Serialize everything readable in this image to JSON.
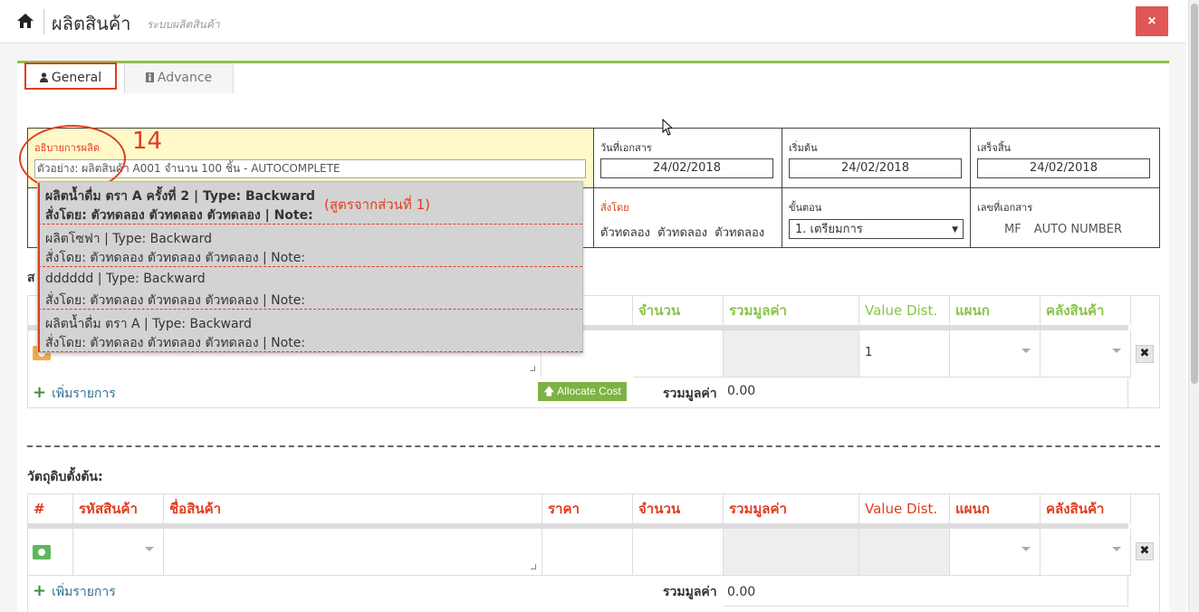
{
  "header": {
    "title": "ผลิตสินค้า",
    "subtitle": "ระบบผลิตสินค้า",
    "close_label": "×"
  },
  "tabs": [
    {
      "label": "General"
    },
    {
      "label": "Advance"
    }
  ],
  "form": {
    "description_label": "อธิบายการผลิต",
    "description_placeholder": "ตัวอย่าง: ผลิตสินค้า A001 จำนวน 100 ชิ้น - AUTOCOMPLETE",
    "doc_date_label": "วันที่เอกสาร",
    "doc_date": "24/02/2018",
    "start_label": "เริ่มต้น",
    "start_date": "24/02/2018",
    "end_label": "เสร็จสิ้น",
    "end_date": "24/02/2018",
    "ordered_by_label": "สั่งโดย",
    "ordered_by": "ตัวทดลอง  ตัวทดลอง  ตัวทดลอง",
    "step_label": "ขั้นตอน",
    "step_value": "1. เตรียมการ",
    "doc_no_label": "เลขที่เอกสาร",
    "doc_no_prefix": "MF",
    "doc_no_value": "AUTO NUMBER"
  },
  "annotation": {
    "number": "14",
    "note": "(สูตรจากส่วนที่ 1)"
  },
  "autocomplete": [
    {
      "line1": "ผลิตน้ำดื่ม ตรา A ครั้งที่ 2 | Type: Backward",
      "line2": "สั่งโดย: ตัวทดลอง ตัวทดลอง ตัวทดลอง | Note:"
    },
    {
      "line1": "ผลิตโซฟา | Type: Backward",
      "line2": "สั่งโดย: ตัวทดลอง ตัวทดลอง ตัวทดลอง | Note:"
    },
    {
      "line1": "dddddd | Type: Backward",
      "line2": "สั่งโดย: ตัวทดลอง ตัวทดลอง ตัวทดลอง | Note:"
    },
    {
      "line1": "ผลิตน้ำดื่ม ตรา A | Type: Backward",
      "line2": "สั่งโดย: ตัวทดลอง ตัวทดลอง ตัวทดลอง | Note:"
    }
  ],
  "products_table": {
    "section_initial": "ส",
    "headers_visible": [
      "จำนวน",
      "รวมมูลค่า",
      "Value Dist.",
      "แผนก",
      "คลังสินค้า"
    ],
    "row_value_dist": "1",
    "add_label": "เพิ่มรายการ",
    "allocate_label": "Allocate Cost",
    "total_label": "รวมมูลค่า",
    "total_value": "0.00"
  },
  "materials_table": {
    "title": "วัตถุดิบตั้งต้น:",
    "headers": [
      "#",
      "รหัสสินค้า",
      "ชื่อสินค้า",
      "ราคา",
      "จำนวน",
      "รวมมูลค่า",
      "Value Dist.",
      "แผนก",
      "คลังสินค้า"
    ],
    "add_label": "เพิ่มรายการ",
    "total_label": "รวมมูลค่า",
    "total_value": "0.00"
  },
  "icons": {
    "home": "home-icon",
    "user": "user-icon",
    "info": "info-icon",
    "close": "close-icon"
  },
  "colors": {
    "accent_green": "#8bc34a",
    "header_red": "#e03c1f",
    "close_btn": "#e05757"
  }
}
